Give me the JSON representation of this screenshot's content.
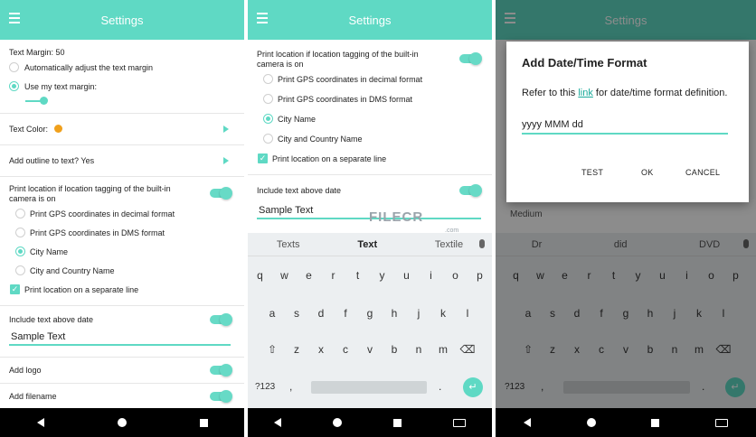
{
  "app": {
    "title": "Settings"
  },
  "screen1": {
    "text_margin_label": "Text Margin: 50",
    "auto_margin": "Automatically adjust the text margin",
    "use_margin": "Use my text margin:",
    "text_color": "Text Color:",
    "outline": "Add outline to text? Yes",
    "print_location_line1": "Print location if location tagging of the built-in",
    "print_location_line2": "camera is on",
    "options": [
      "Print GPS coordinates in decimal format",
      "Print GPS coordinates in DMS format",
      "City Name",
      "City and Country Name"
    ],
    "separate_line": "Print location on a separate line",
    "include_text": "Include text above date",
    "input_value": "Sample Text",
    "add_logo": "Add logo",
    "add_filename": "Add filename",
    "colors": {
      "accent": "#5fd9c4",
      "text_color_dot": "#f0a01c"
    }
  },
  "screen2": {
    "print_location_line1": "Print location if location tagging of the built-in",
    "print_location_line2": "camera is on",
    "options": [
      "Print GPS coordinates in decimal format",
      "Print GPS coordinates in DMS format",
      "City Name",
      "City and Country Name"
    ],
    "separate_line": "Print location on a separate line",
    "include_text": "Include text above date",
    "input_value": "Sample Text",
    "suggestions": [
      "Texts",
      "Text",
      "Textile"
    ],
    "watermark": "FILECR",
    "watermark_sub": ".com"
  },
  "screen3": {
    "dialog_title": "Add Date/Time Format",
    "body_before": "Refer to this ",
    "body_link": "link",
    "body_after": " for date/time format definition.",
    "input_value": "yyyy MMM dd",
    "buttons": [
      "TEST",
      "OK",
      "CANCEL"
    ],
    "behind_value": "Medium",
    "suggestions": [
      "Dr",
      "did",
      "DVD"
    ]
  },
  "keyboard": {
    "row1": [
      "q",
      "w",
      "e",
      "r",
      "t",
      "y",
      "u",
      "i",
      "o",
      "p"
    ],
    "row2": [
      "a",
      "s",
      "d",
      "f",
      "g",
      "h",
      "j",
      "k",
      "l"
    ],
    "row3": [
      "z",
      "x",
      "c",
      "v",
      "b",
      "n",
      "m"
    ],
    "sym": "?123",
    "comma": ",",
    "period": "."
  }
}
